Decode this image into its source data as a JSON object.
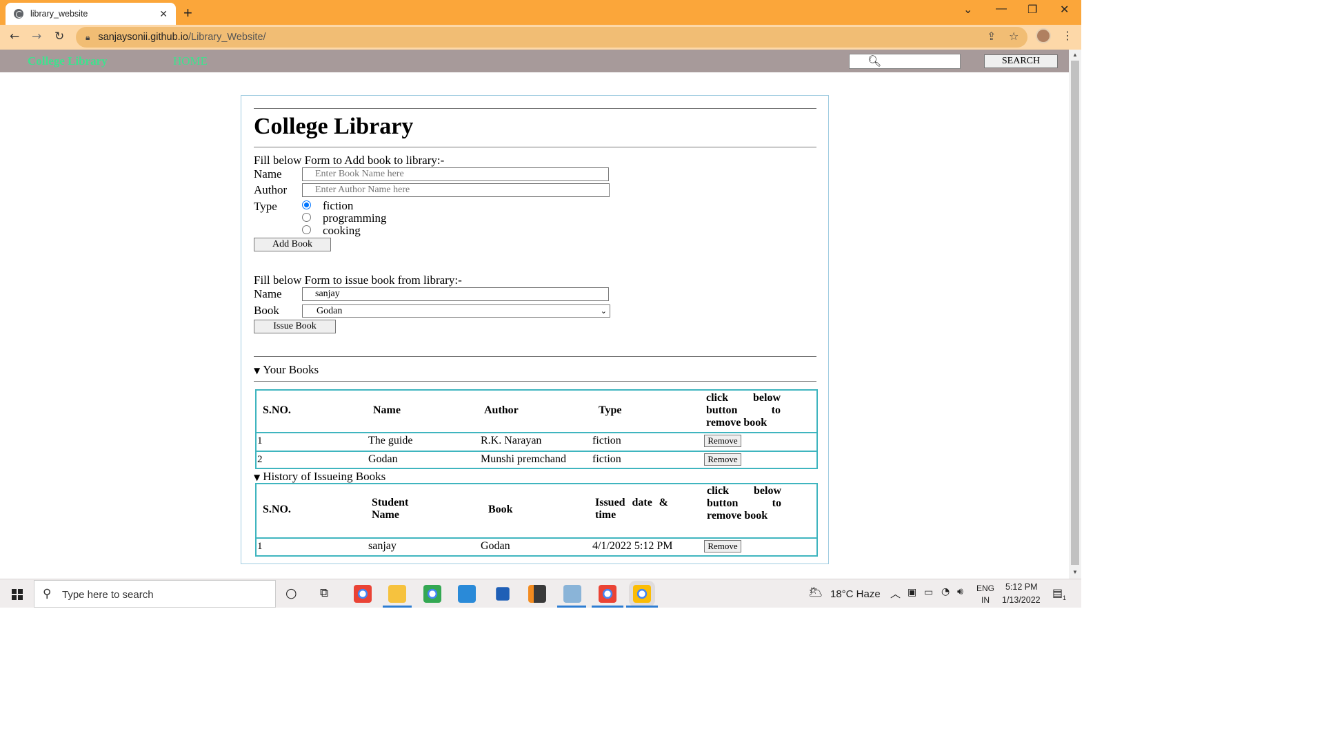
{
  "browser": {
    "tab_title": "library_website",
    "tab_close": "✕",
    "new_tab": "+",
    "url_domain": "sanjaysonii.github.io",
    "url_path": "/Library_Website/",
    "colors": {
      "titlebar": "#fba63a",
      "toolbar": "#fdd8a8"
    }
  },
  "site_nav": {
    "brand": "College Library",
    "home": "HOME",
    "search_value": "",
    "search_button": "SEARCH",
    "colors": {
      "bar": "#a79a9a",
      "link": "#3ee28e"
    }
  },
  "page": {
    "title": "College Library",
    "add_form": {
      "heading": "Fill below Form to Add book to library:-",
      "name_label": "Name",
      "name_placeholder": "Enter Book Name here",
      "author_label": "Author",
      "author_placeholder": "Enter Author Name here",
      "type_label": "Type",
      "types": [
        "fiction",
        "programming",
        "cooking"
      ],
      "selected_type": "fiction",
      "add_button": "Add Book"
    },
    "issue_form": {
      "heading": "Fill below Form to issue book from library:-",
      "name_label": "Name",
      "name_value": "sanjay",
      "book_label": "Book",
      "book_selected": "Godan",
      "issue_button": "Issue Book"
    },
    "your_books": {
      "summary": "Your Books",
      "headers": [
        "S.NO.",
        "Name",
        "Author",
        "Type",
        "click below button to remove book"
      ],
      "rows": [
        {
          "sno": "1",
          "name": "The guide",
          "author": "R.K. Narayan",
          "type": "fiction",
          "action": "Remove"
        },
        {
          "sno": "2",
          "name": "Godan",
          "author": "Munshi premchand",
          "type": "fiction",
          "action": "Remove"
        }
      ]
    },
    "history": {
      "summary": "History of Issueing Books",
      "headers": [
        "S.NO.",
        "Student Name",
        "Book",
        "Issued date & time",
        "click below button to remove book"
      ],
      "rows": [
        {
          "sno": "1",
          "student": "sanjay",
          "book": "Godan",
          "issued": "4/1/2022 5:12 PM",
          "action": "Remove"
        }
      ]
    },
    "colors": {
      "container_border": "#9ecbe0",
      "table_border": "#3fb5bf"
    }
  },
  "taskbar": {
    "search_placeholder": "Type here to search",
    "weather": "18°C  Haze",
    "language_top": "ENG",
    "language_bottom": "IN",
    "time": "5:12 PM",
    "date": "1/13/2022",
    "notification_count": "1"
  }
}
